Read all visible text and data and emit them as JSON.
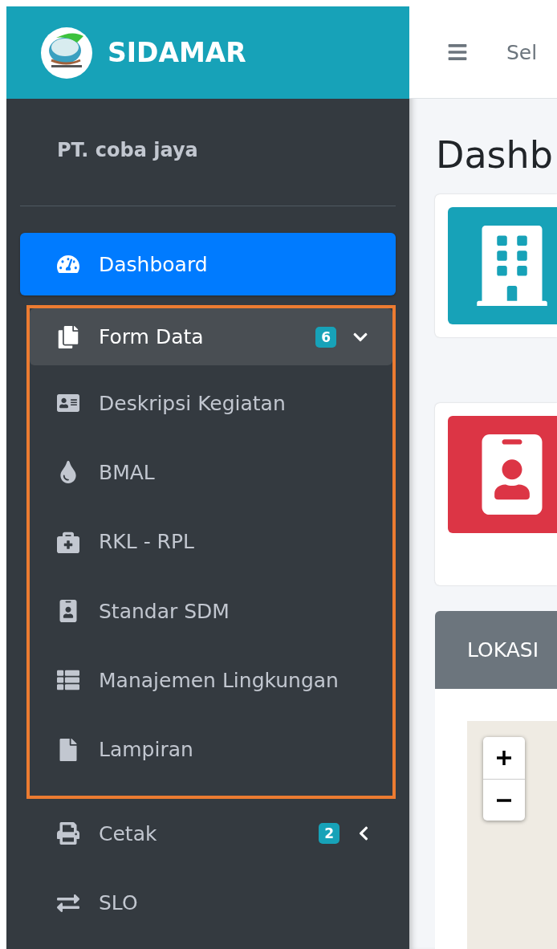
{
  "brand": {
    "name": "SIDAMAR"
  },
  "user": {
    "name": "PT. coba jaya"
  },
  "nav": [
    {
      "label": "Dashboard",
      "selected": true
    },
    {
      "label": "Form Data",
      "selected": false,
      "badge": "6",
      "expanded": true,
      "highlighted": true,
      "children": [
        {
          "label": "Deskripsi Kegiatan"
        },
        {
          "label": "BMAL"
        },
        {
          "label": "RKL - RPL"
        },
        {
          "label": "Standar SDM"
        },
        {
          "label": "Manajemen Lingkungan"
        },
        {
          "label": "Lampiran"
        }
      ]
    },
    {
      "label": "Cetak",
      "selected": false,
      "badge": "2",
      "expanded": false
    },
    {
      "label": "SLO",
      "selected": false
    }
  ],
  "topbar": {
    "text": "Sel"
  },
  "content": {
    "title": "Dashb",
    "cards": [
      {
        "color": "#17a2b8"
      },
      {
        "color": "#dc3545"
      }
    ],
    "map_card": {
      "title": "LOKASI"
    }
  }
}
